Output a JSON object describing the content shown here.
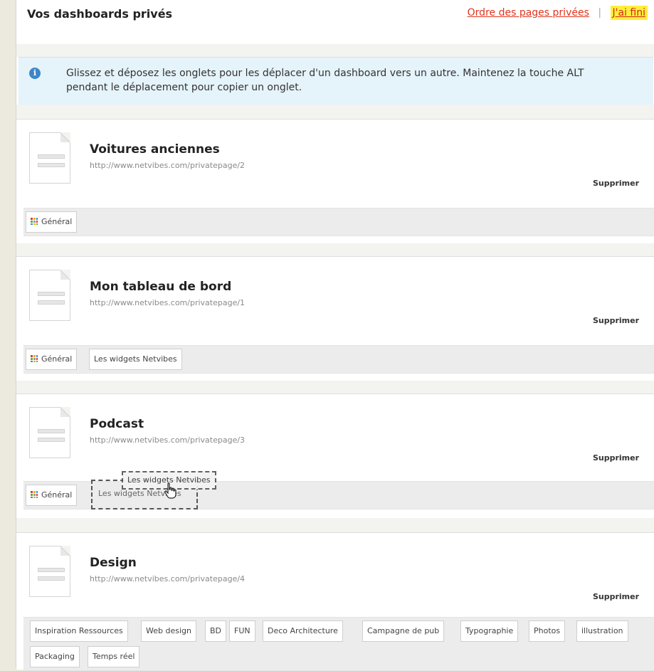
{
  "header": {
    "title": "Vos dashboards privés",
    "order_link": "Ordre des pages privées",
    "separator": "|",
    "done_link": "J'ai fini"
  },
  "info": {
    "icon": "info-icon",
    "text": "Glissez et déposez les onglets pour les déplacer d'un dashboard vers un autre. Maintenez la touche ALT pendant le déplacement pour copier un onglet."
  },
  "dashboards": [
    {
      "title": "Voitures anciennes",
      "url": "http://www.netvibes.com/privatepage/2",
      "delete_label": "Supprimer",
      "tabs": [
        "Général"
      ]
    },
    {
      "title": "Mon tableau de bord",
      "url": "http://www.netvibes.com/privatepage/1",
      "delete_label": "Supprimer",
      "tabs": [
        "Général",
        "Les widgets Netvibes"
      ]
    },
    {
      "title": "Podcast",
      "url": "http://www.netvibes.com/privatepage/3",
      "delete_label": "Supprimer",
      "tabs": [
        "Général",
        "Les widgets Netvibes"
      ],
      "dragging_tab": "Les widgets Netvibes"
    },
    {
      "title": "Design",
      "url": "http://www.netvibes.com/privatepage/4",
      "delete_label": "Supprimer",
      "tabs": [
        "Inspiration Ressources",
        "Web design",
        "BD",
        "FUN",
        "Deco Architecture",
        "Campagne de pub",
        "Typographie",
        "Photos",
        "illustration",
        "Packaging",
        "Temps réel"
      ]
    }
  ],
  "colors": {
    "link_red": "#e0341f",
    "highlight_yellow": "#ffef3a",
    "info_bg": "#e5f3fa",
    "info_icon": "#3f86c8",
    "tabbar_bg": "#ececec"
  }
}
